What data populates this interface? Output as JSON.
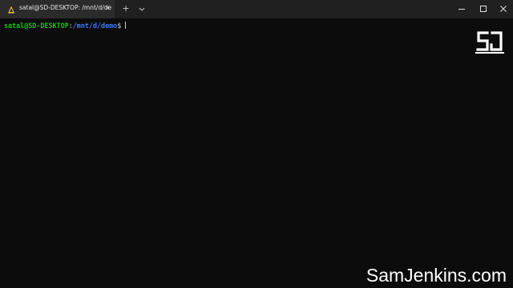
{
  "tab": {
    "title": "satal@SD-DESKTOP: /mnt/d/de",
    "close_icon": "close-icon",
    "app_icon": "linux-penguin-icon"
  },
  "tabbar": {
    "new_tab_icon": "plus-icon",
    "dropdown_icon": "chevron-down-icon"
  },
  "window_controls": {
    "minimize_icon": "minimize-icon",
    "maximize_icon": "maximize-icon",
    "close_icon": "close-icon"
  },
  "terminal": {
    "prompt_user": "satal@SD-DESKTOP",
    "prompt_colon": ":",
    "prompt_path": "/mnt/d/demo",
    "prompt_symbol": "$",
    "input": ""
  },
  "watermark": {
    "logo_icon": "sj-logo-icon",
    "site": "SamJenkins.com"
  },
  "colors": {
    "background": "#0c0c0c",
    "tabbar": "#202020",
    "active_tab": "#2b2b2b",
    "prompt_user": "#16c60c",
    "prompt_path": "#3b78ff",
    "text": "#cccccc"
  }
}
